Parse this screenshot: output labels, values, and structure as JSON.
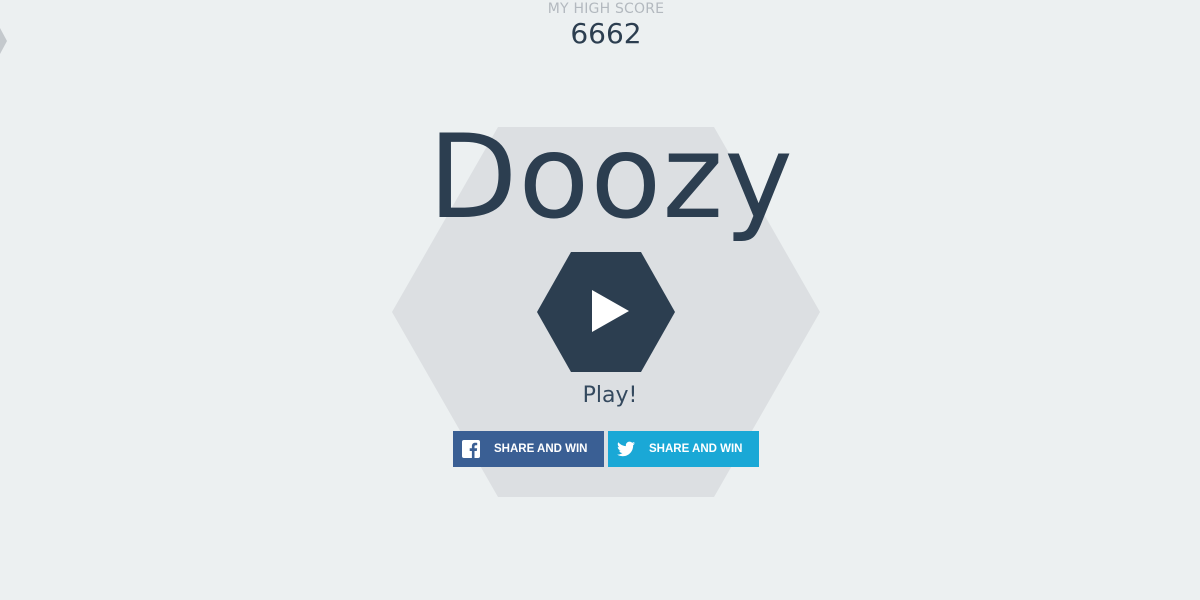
{
  "high_score": {
    "label": "MY HIGH SCORE",
    "value": "6662"
  },
  "game": {
    "title": "Doozy",
    "play_label": "Play!"
  },
  "share": {
    "facebook_label": "SHARE AND WIN",
    "twitter_label": "SHARE AND WIN"
  },
  "icons": {
    "play": "play-icon",
    "facebook": "facebook-icon",
    "twitter": "twitter-icon",
    "corner": "hexagon-corner-icon"
  },
  "colors": {
    "background": "#ecf0f1",
    "hex_fill": "#dcdfe2",
    "primary": "#2c3e50",
    "facebook": "#3a5f94",
    "twitter": "#1aa8d6",
    "muted_text": "#b3b9bf"
  }
}
